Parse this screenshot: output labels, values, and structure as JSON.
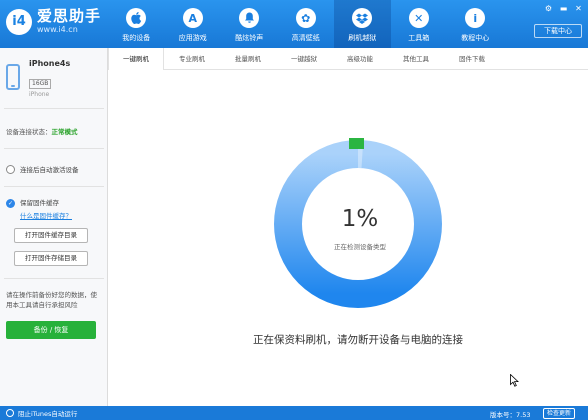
{
  "brand": {
    "mark": "i4",
    "name": "爱思助手",
    "url": "www.i4.cn"
  },
  "nav": [
    {
      "label": "我的设备",
      "icon": "apple-icon",
      "glyph": ""
    },
    {
      "label": "应用游戏",
      "icon": "app-store-icon",
      "glyph": "A"
    },
    {
      "label": "酷炫铃声",
      "icon": "bell-icon",
      "glyph": "♪"
    },
    {
      "label": "高清壁纸",
      "icon": "flower-icon",
      "glyph": "✿"
    },
    {
      "label": "刷机越狱",
      "icon": "dropbox-icon",
      "glyph": "◆"
    },
    {
      "label": "工具箱",
      "icon": "tools-icon",
      "glyph": "✕"
    },
    {
      "label": "教程中心",
      "icon": "info-icon",
      "glyph": "i"
    }
  ],
  "window": {
    "download_center": "下载中心"
  },
  "device": {
    "name": "iPhone4s",
    "storage": "16GB",
    "model": "iPhone"
  },
  "sidebar": {
    "status_label": "设备连接状态：",
    "status_value": "正常模式",
    "auto_activate": "连接后自动激活设备",
    "keep_firmware": "保留固件缓存",
    "what_is_firmware": "什么是固件缓存？",
    "open_firmware_cache": "打开固件缓存目录",
    "open_firmware_storage": "打开固件存储目录",
    "warning": "请在操作前备份好您的数据，使用本工具请自行承担风险",
    "backup_button": "备份 / 恢复"
  },
  "tabs": [
    "一键刷机",
    "专业刷机",
    "批量刷机",
    "一键越狱",
    "高级功能",
    "其他工具",
    "固件下载"
  ],
  "progress": {
    "percent_label": "1%",
    "percent_value": 1,
    "checking_label": "正在检测设备类型",
    "message": "正在保资料刷机，请勿断开设备与电脑的连接"
  },
  "statusbar": {
    "itunes_autorun": "阻止iTunes自动运行",
    "version": "版本号：7.53",
    "check_update": "检查更新"
  },
  "colors": {
    "primary": "#1a82e2",
    "success": "#27b13a",
    "ring_light": "#8cc2f7",
    "ring_dark": "#2b8ef0"
  }
}
